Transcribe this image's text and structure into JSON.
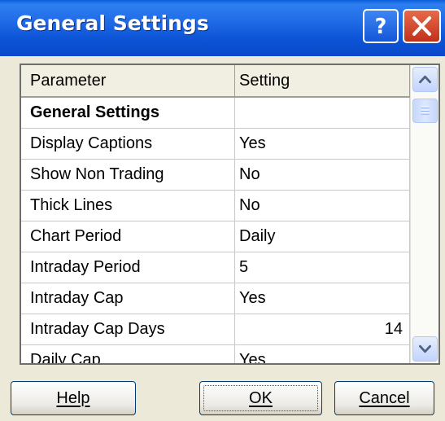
{
  "window": {
    "title": "General Settings",
    "help_icon": "question-mark-icon",
    "close_icon": "close-icon"
  },
  "grid": {
    "columns": [
      "Parameter",
      "Setting"
    ],
    "rows": [
      {
        "parameter": "General Settings",
        "setting": "",
        "section": true
      },
      {
        "parameter": "Display Captions",
        "setting": "Yes"
      },
      {
        "parameter": "Show Non Trading",
        "setting": "No"
      },
      {
        "parameter": "Thick Lines",
        "setting": "No"
      },
      {
        "parameter": "Chart Period",
        "setting": "Daily"
      },
      {
        "parameter": "Intraday Period",
        "setting": "5"
      },
      {
        "parameter": "Intraday Cap",
        "setting": "Yes"
      },
      {
        "parameter": "Intraday Cap Days",
        "setting": "14",
        "align": "right"
      },
      {
        "parameter": "Daily Cap",
        "setting": "Yes"
      }
    ]
  },
  "buttons": {
    "help": "Help",
    "ok": "OK",
    "cancel": "Cancel"
  },
  "colors": {
    "titlebar": "#0a54d8",
    "dialog_bg": "#ece9d8",
    "close_button": "#d9481f"
  }
}
